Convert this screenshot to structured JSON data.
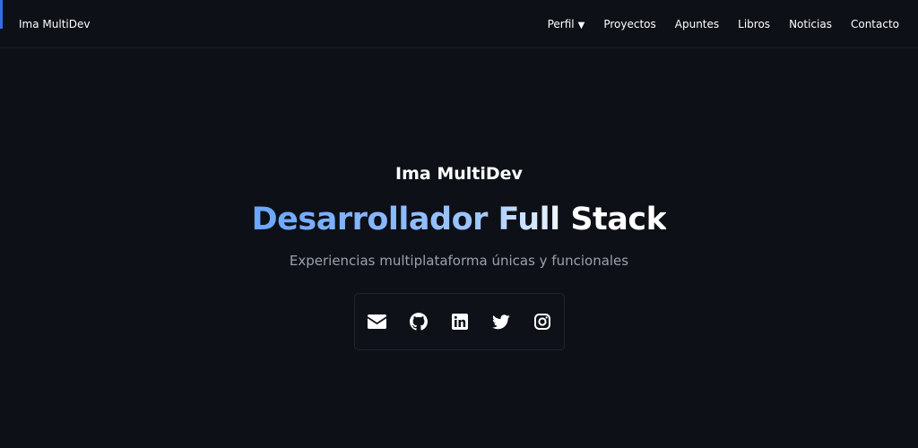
{
  "navbar": {
    "brand": "Ima MultiDev",
    "items": [
      {
        "label": "Perfil",
        "has_dropdown": true,
        "caret": "▼"
      },
      {
        "label": "Proyectos"
      },
      {
        "label": "Apuntes"
      },
      {
        "label": "Libros"
      },
      {
        "label": "Noticias"
      },
      {
        "label": "Contacto"
      }
    ],
    "accent_color": "#2f6fe8"
  },
  "hero": {
    "name": "Ima MultiDev",
    "title": "Desarrollador Full Stack",
    "subtitle": "Experiencias multiplataforma únicas y funcionales",
    "title_gradient": [
      "#6aa5ff",
      "#9fc6ff",
      "#ffffff"
    ]
  },
  "social": [
    {
      "icon": "envelope-icon"
    },
    {
      "icon": "github-icon"
    },
    {
      "icon": "linkedin-icon"
    },
    {
      "icon": "twitter-icon"
    },
    {
      "icon": "instagram-icon"
    }
  ],
  "colors": {
    "background": "#0d1017",
    "text": "#ffffff",
    "muted": "#9aa1ad"
  }
}
